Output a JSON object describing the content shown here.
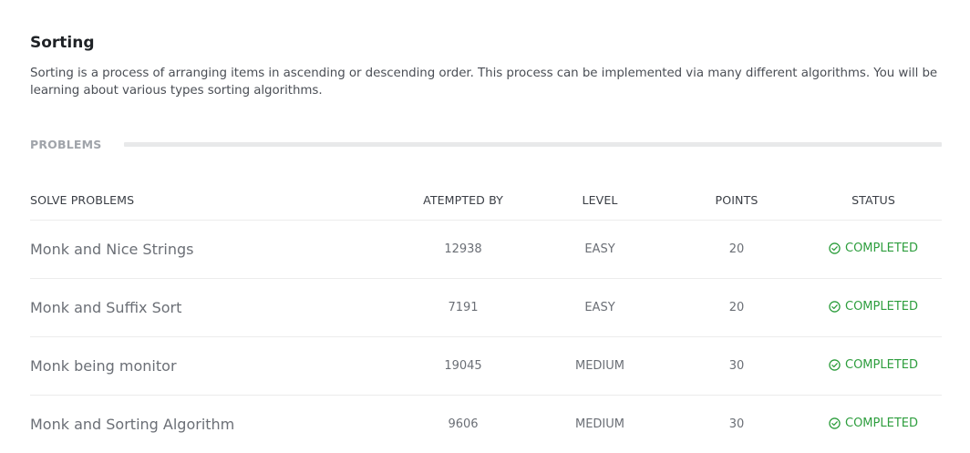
{
  "topic": {
    "title": "Sorting",
    "description": "Sorting is a process of arranging items in ascending or descending order. This process can be implemented via many different algorithms. You will be learning about various types sorting algorithms."
  },
  "section": {
    "label": "PROBLEMS"
  },
  "table": {
    "headers": {
      "name": "SOLVE PROBLEMS",
      "attempted": "ATEMPTED BY",
      "level": "LEVEL",
      "points": "POINTS",
      "status": "STATUS"
    },
    "rows": [
      {
        "name": "Monk and Nice Strings",
        "attempted": "12938",
        "level": "EASY",
        "points": "20",
        "status": "COMPLETED"
      },
      {
        "name": "Monk and Suffix Sort",
        "attempted": "7191",
        "level": "EASY",
        "points": "20",
        "status": "COMPLETED"
      },
      {
        "name": "Monk being monitor",
        "attempted": "19045",
        "level": "MEDIUM",
        "points": "30",
        "status": "COMPLETED"
      },
      {
        "name": "Monk and Sorting Algorithm",
        "attempted": "9606",
        "level": "MEDIUM",
        "points": "30",
        "status": "COMPLETED"
      }
    ]
  },
  "colors": {
    "completed": "#2e9e3e",
    "muted_text": "#6b6f76",
    "section_label": "#a0a4aa"
  },
  "icons": {
    "status": "check-circle-icon"
  }
}
